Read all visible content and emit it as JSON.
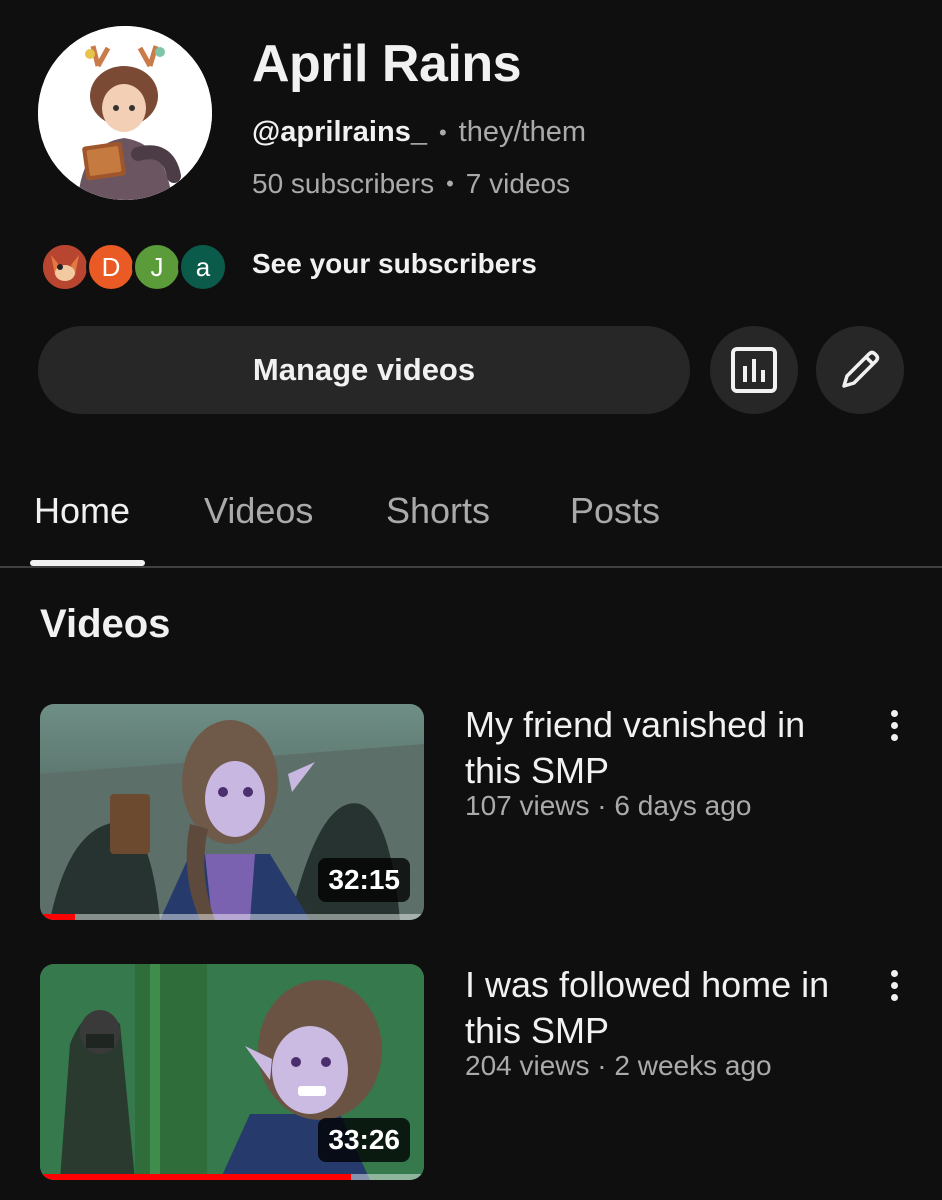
{
  "channel": {
    "name": "April Rains",
    "handle": "@aprilrains_",
    "pronouns": "they/them",
    "subscribers": "50 subscribers",
    "videos_count": "7 videos"
  },
  "subscribers_preview": {
    "initials": [
      "D",
      "J",
      "a"
    ],
    "label": "See your subscribers"
  },
  "actions": {
    "manage_label": "Manage videos",
    "analytics_icon": "analytics-icon",
    "edit_icon": "pencil-icon"
  },
  "tabs": [
    {
      "label": "Home",
      "active": true
    },
    {
      "label": "Videos",
      "active": false
    },
    {
      "label": "Shorts",
      "active": false
    },
    {
      "label": "Posts",
      "active": false
    }
  ],
  "section": {
    "title": "Videos"
  },
  "videos": [
    {
      "title": "My friend vanished in this SMP",
      "meta": "107 views · 6 days ago",
      "duration": "32:15",
      "progress": 0.09
    },
    {
      "title": "I was followed home in this SMP",
      "meta": "204 views · 2 weeks ago",
      "duration": "33:26",
      "progress": 0.81
    }
  ],
  "colors": {
    "background": "#0f0f0f",
    "button": "#272727",
    "progress": "#ff0000",
    "muted_text": "#aaaaaa"
  }
}
